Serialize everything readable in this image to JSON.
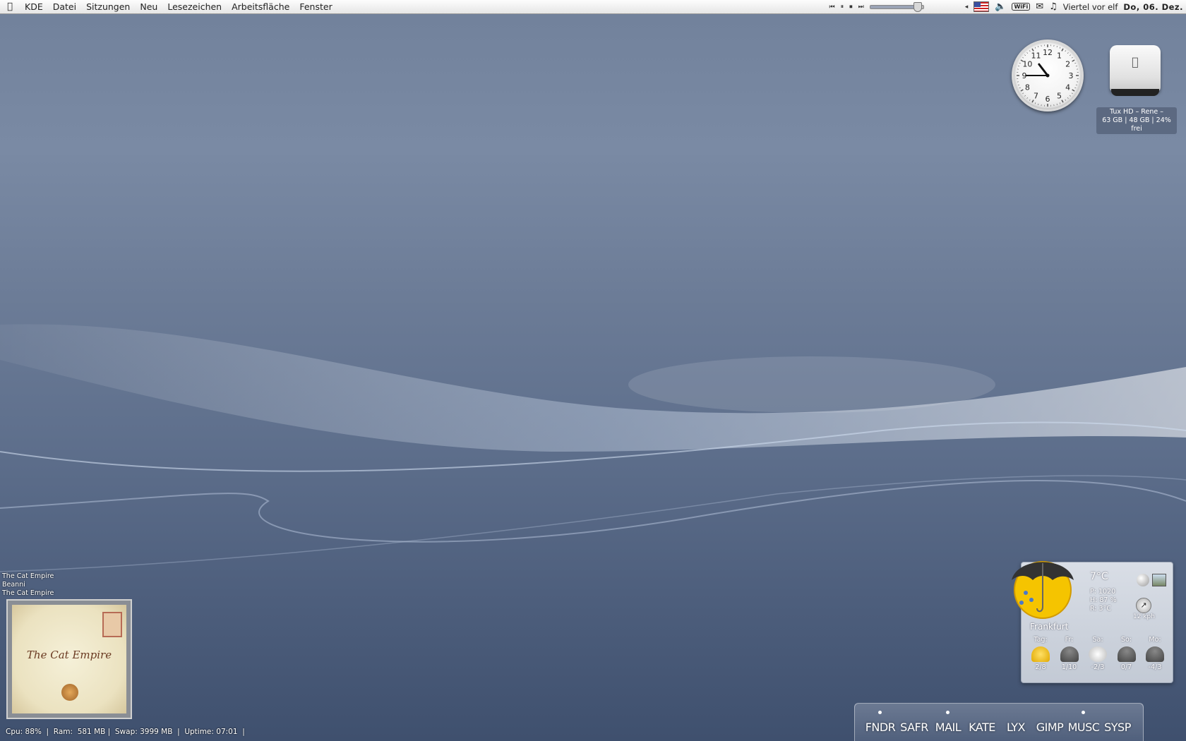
{
  "menubar": {
    "app_name": "KDE",
    "items": [
      "Datei",
      "Sitzungen",
      "Neu",
      "Lesezeichen",
      "Arbeitsfläche",
      "Fenster"
    ],
    "volume_level": 0.88,
    "clock_text": "Viertel vor elf",
    "date_text": "Do, 06. Dez."
  },
  "desktop_clock": {
    "numbers": [
      "12",
      "1",
      "2",
      "3",
      "4",
      "5",
      "6",
      "7",
      "8",
      "9",
      "10",
      "11"
    ],
    "time": "10:45"
  },
  "hard_drive": {
    "name_line": "Tux HD  –  Rene  –",
    "info_line": "63 GB | 48 GB | 24% frei"
  },
  "now_playing": {
    "title": "The Cat Empire",
    "track": "Beanni",
    "album": "The Cat Empire",
    "cover_text": "The Cat Empire"
  },
  "sysbar": {
    "text": "Cpu: 88%  |  Ram:  581 MB |  Swap: 3999 MB  |  Uptime: 07:01  |"
  },
  "weather": {
    "temp": "7°C",
    "pressure": "P:  1020",
    "humidity": "H:  87 %",
    "dewpoint": "R:  3°C",
    "wind": "12 kph",
    "city": "Frankfurt",
    "days": [
      {
        "label": "Tag:",
        "range": "2/8",
        "icon": "sun-rain"
      },
      {
        "label": "Fr:",
        "range": "1/10",
        "icon": "rain"
      },
      {
        "label": "Sa:",
        "range": "-2/3",
        "icon": "cloud"
      },
      {
        "label": "So:",
        "range": "0/7",
        "icon": "rain"
      },
      {
        "label": "Mo:",
        "range": "-4/3",
        "icon": "rain"
      }
    ]
  },
  "dock": {
    "items": [
      {
        "label": "FNDR",
        "running": true
      },
      {
        "label": "SAFR",
        "running": false
      },
      {
        "label": "MAIL",
        "running": true
      },
      {
        "label": "KATE",
        "running": false
      },
      {
        "label": "LYX",
        "running": false
      },
      {
        "label": "GIMP",
        "running": false
      },
      {
        "label": "MUSC",
        "running": true
      },
      {
        "label": "SYSP",
        "running": false
      }
    ]
  }
}
